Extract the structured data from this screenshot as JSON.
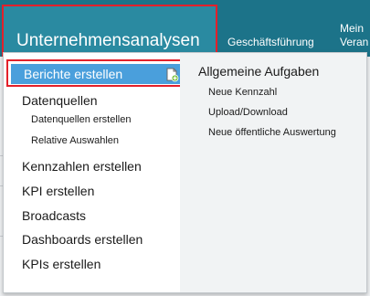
{
  "topnav": {
    "primary": "Unternehmensanalysen",
    "items": [
      {
        "label": "Geschäftsführung"
      },
      {
        "label": "Mein"
      },
      {
        "label": "Veran"
      }
    ]
  },
  "menu": {
    "left": {
      "highlighted": "Berichte erstellen",
      "datenquellen": "Datenquellen",
      "datenquellen_sub": [
        "Datenquellen erstellen",
        "Relative Auswahlen"
      ],
      "items": [
        "Kennzahlen erstellen",
        "KPI erstellen",
        "Broadcasts",
        "Dashboards erstellen",
        "KPIs erstellen"
      ]
    },
    "right": {
      "title": "Allgemeine Aufgaben",
      "links": [
        "Neue Kennzahl",
        "Upload/Download",
        "Neue öffentliche Auswertung"
      ]
    }
  },
  "colors": {
    "topbar": "#1c7389",
    "highlight": "#4a9fdc",
    "annotation": "#e3202a"
  },
  "icons": {
    "new_report": "new-document-icon"
  }
}
